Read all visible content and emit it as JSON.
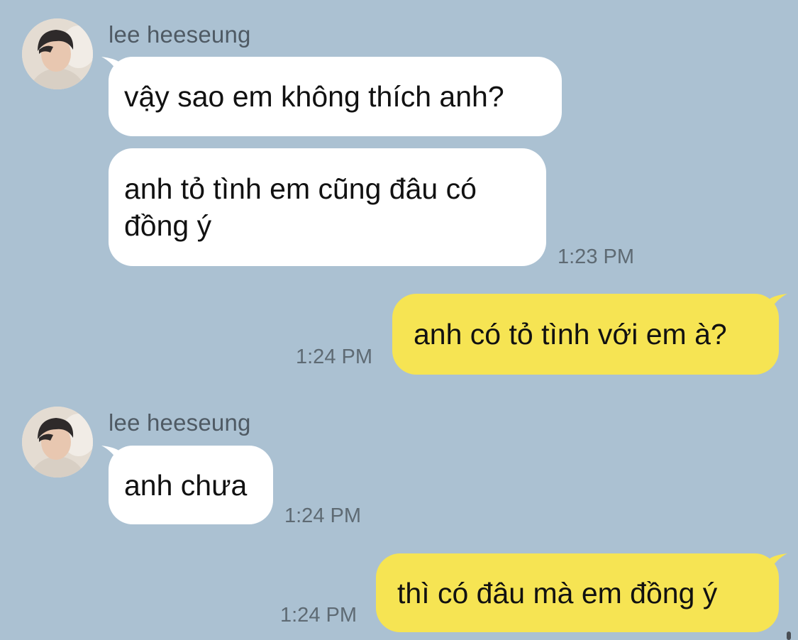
{
  "colors": {
    "background": "#abc1d2",
    "incoming_bubble": "#ffffff",
    "outgoing_bubble": "#f6e453",
    "timestamp": "#5e6a73",
    "sender_name": "#4f5a64"
  },
  "messages": [
    {
      "sender": "lee heeseung",
      "avatar_icon": "profile-photo",
      "direction": "incoming",
      "bubbles": [
        "vậy sao em không thích anh?",
        "anh tỏ tình em cũng đâu có\nđồng ý"
      ],
      "time": "1:23 PM"
    },
    {
      "direction": "outgoing",
      "bubbles": [
        "anh có tỏ tình với em à?"
      ],
      "time": "1:24 PM"
    },
    {
      "sender": "lee heeseung",
      "avatar_icon": "profile-photo",
      "direction": "incoming",
      "bubbles": [
        "anh chưa"
      ],
      "time": "1:24 PM"
    },
    {
      "direction": "outgoing",
      "bubbles": [
        "thì có đâu mà em đồng ý"
      ],
      "time": "1:24 PM"
    }
  ]
}
